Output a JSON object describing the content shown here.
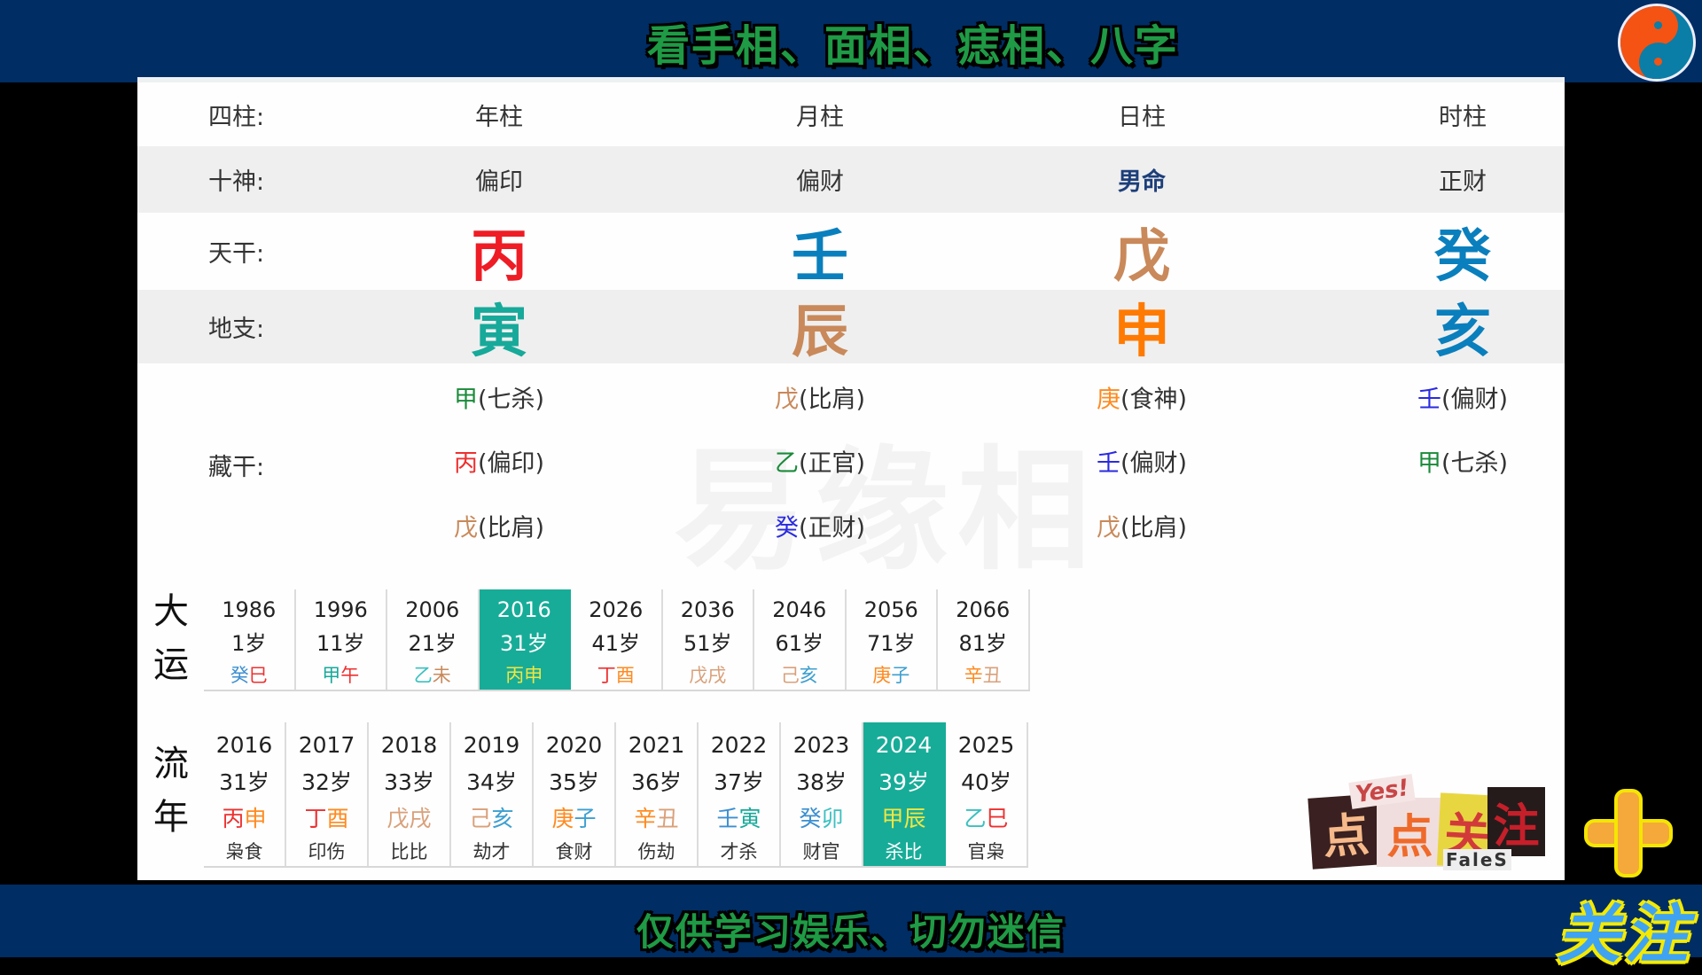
{
  "banner": {
    "top_title": "看手相、面相、痣相、八字",
    "bottom_title": "仅供学习娱乐、切勿迷信",
    "watermark": "易缘相"
  },
  "colors": {
    "bar_bg": "#002d64",
    "title_green": "#1f9a45",
    "highlight": "#17ac98",
    "red": "#ee1c25",
    "blue": "#0a7fbd",
    "tan": "#c9895a",
    "teal": "#17a99a",
    "orange": "#ff7a00"
  },
  "pillars": {
    "row_labels": {
      "columns": "四柱:",
      "ten_gods": "十神:",
      "heavenly": "天干:",
      "earthly": "地支:",
      "hidden": "藏干:"
    },
    "columns": [
      {
        "name": "年柱",
        "ten_god": "偏印",
        "stem": "丙",
        "stem_color": "#ee1c25",
        "branch": "寅",
        "branch_color": "#17a99a",
        "hidden": [
          {
            "stem": "甲",
            "color": "#1a8a3a",
            "god": "(七杀)"
          },
          {
            "stem": "丙",
            "color": "#ee3030",
            "god": "(偏印)"
          },
          {
            "stem": "戊",
            "color": "#c9895a",
            "god": "(比肩)"
          }
        ]
      },
      {
        "name": "月柱",
        "ten_god": "偏财",
        "stem": "壬",
        "stem_color": "#0a7fbd",
        "branch": "辰",
        "branch_color": "#c9895a",
        "hidden": [
          {
            "stem": "戊",
            "color": "#c9895a",
            "god": "(比肩)"
          },
          {
            "stem": "乙",
            "color": "#1a8a3a",
            "god": "(正官)"
          },
          {
            "stem": "癸",
            "color": "#2a2ae0",
            "god": "(正财)"
          }
        ]
      },
      {
        "name": "日柱",
        "ten_god": "男命",
        "stem": "戊",
        "stem_color": "#c9895a",
        "branch": "申",
        "branch_color": "#ff7a00",
        "hidden": [
          {
            "stem": "庚",
            "color": "#ff8a20",
            "god": "(食神)"
          },
          {
            "stem": "壬",
            "color": "#2a2ae0",
            "god": "(偏财)"
          },
          {
            "stem": "戊",
            "color": "#c9895a",
            "god": "(比肩)"
          }
        ]
      },
      {
        "name": "时柱",
        "ten_god": "正财",
        "stem": "癸",
        "stem_color": "#0a7fbd",
        "branch": "亥",
        "branch_color": "#0a7fbd",
        "hidden": [
          {
            "stem": "壬",
            "color": "#2a2ae0",
            "god": "(偏财)"
          },
          {
            "stem": "甲",
            "color": "#1a8a3a",
            "god": "(七杀)"
          }
        ]
      }
    ]
  },
  "dayun": {
    "label_1": "大",
    "label_2": "运",
    "active_index": 3,
    "cells": [
      {
        "year": "1986",
        "age": "1岁",
        "g1": "癸",
        "c1": "#3c8fd0",
        "g2": "巳",
        "c2": "#ee3030"
      },
      {
        "year": "1996",
        "age": "11岁",
        "g1": "甲",
        "c1": "#17a99a",
        "g2": "午",
        "c2": "#ee3030"
      },
      {
        "year": "2006",
        "age": "21岁",
        "g1": "乙",
        "c1": "#3cc0c0",
        "g2": "未",
        "c2": "#c9895a"
      },
      {
        "year": "2016",
        "age": "31岁",
        "g1": "丙",
        "c1": "#f2e640",
        "g2": "申",
        "c2": "#f2e640"
      },
      {
        "year": "2026",
        "age": "41岁",
        "g1": "丁",
        "c1": "#ee3030",
        "g2": "酉",
        "c2": "#ff8a20"
      },
      {
        "year": "2036",
        "age": "51岁",
        "g1": "戊",
        "c1": "#d9a07a",
        "g2": "戌",
        "c2": "#d9a07a"
      },
      {
        "year": "2046",
        "age": "61岁",
        "g1": "己",
        "c1": "#d9a07a",
        "g2": "亥",
        "c2": "#3c9fd0"
      },
      {
        "year": "2056",
        "age": "71岁",
        "g1": "庚",
        "c1": "#ff8a20",
        "g2": "子",
        "c2": "#3c9fd0"
      },
      {
        "year": "2066",
        "age": "81岁",
        "g1": "辛",
        "c1": "#ff8a20",
        "g2": "丑",
        "c2": "#d9a07a"
      }
    ]
  },
  "liunian": {
    "label_1": "流",
    "label_2": "年",
    "active_index": 8,
    "cells": [
      {
        "year": "2016",
        "age": "31岁",
        "g1": "丙",
        "c1": "#ee3030",
        "g2": "申",
        "c2": "#ff8a20",
        "gods": "枭食"
      },
      {
        "year": "2017",
        "age": "32岁",
        "g1": "丁",
        "c1": "#ee3030",
        "g2": "酉",
        "c2": "#ff8a20",
        "gods": "印伤"
      },
      {
        "year": "2018",
        "age": "33岁",
        "g1": "戊",
        "c1": "#d9a07a",
        "g2": "戌",
        "c2": "#d9a07a",
        "gods": "比比"
      },
      {
        "year": "2019",
        "age": "34岁",
        "g1": "己",
        "c1": "#d9a07a",
        "g2": "亥",
        "c2": "#3c9fd0",
        "gods": "劫才"
      },
      {
        "year": "2020",
        "age": "35岁",
        "g1": "庚",
        "c1": "#ff8a20",
        "g2": "子",
        "c2": "#3c9fd0",
        "gods": "食财"
      },
      {
        "year": "2021",
        "age": "36岁",
        "g1": "辛",
        "c1": "#ff8a20",
        "g2": "丑",
        "c2": "#d9a07a",
        "gods": "伤劫"
      },
      {
        "year": "2022",
        "age": "37岁",
        "g1": "壬",
        "c1": "#3c8fd0",
        "g2": "寅",
        "c2": "#17a99a",
        "gods": "才杀"
      },
      {
        "year": "2023",
        "age": "38岁",
        "g1": "癸",
        "c1": "#3c8fd0",
        "g2": "卯",
        "c2": "#3cc0c0",
        "gods": "财官"
      },
      {
        "year": "2024",
        "age": "39岁",
        "g1": "甲",
        "c1": "#f2e640",
        "g2": "辰",
        "c2": "#f2e640",
        "gods": "杀比"
      },
      {
        "year": "2025",
        "age": "40岁",
        "g1": "乙",
        "c1": "#3cc0c0",
        "g2": "巳",
        "c2": "#ee3030",
        "gods": "官枭"
      }
    ]
  },
  "promo": {
    "sticker_chars": [
      "点",
      "点",
      "关",
      "注"
    ],
    "sticker_yes": "Yes!",
    "sticker_sub": "FaleS",
    "follow_text": "关注"
  }
}
